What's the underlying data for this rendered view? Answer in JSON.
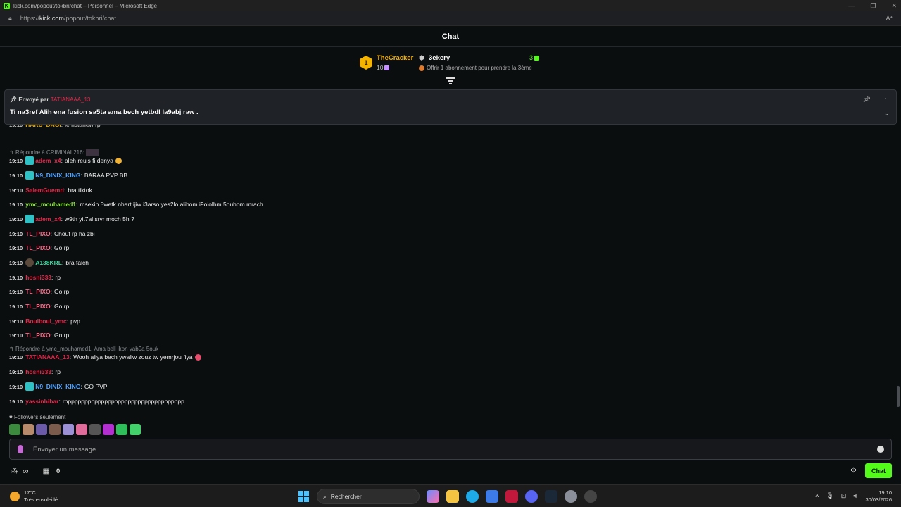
{
  "browser": {
    "window_title": "kick.com/popout/tokbri/chat – Personnel – Microsoft Edge",
    "url_prefix": "https://",
    "url_host": "kick.com",
    "url_path": "/popout/tokbri/chat"
  },
  "chat_header": {
    "title": "Chat"
  },
  "leaderboard": {
    "first": {
      "rank": "1",
      "name": "TheCracker",
      "gifts": "10"
    },
    "second": {
      "name": "3ekery",
      "gifts": "3",
      "offer": "Offrir 1 abonnement pour prendre la 3ème"
    }
  },
  "pinned": {
    "sent_by_label": "Envoyé par",
    "sender": "TATIANAAA_13",
    "message": "Ti na3ref Alih ena fusion sa5ta ama bech yetbdl la9abj raw ."
  },
  "messages": [
    {
      "time": "19:10",
      "user": "HAKU_DAGI",
      "color": "#f4b400",
      "text": "le nstanew rp",
      "badge": false
    },
    {
      "reply_to": "Répondre à CRIMINAL216:"
    },
    {
      "time": "19:10",
      "user": "adem_x4",
      "color": "#e8264a",
      "text": "aleh reuls fi denya",
      "badge": true,
      "emoji": "smile"
    },
    {
      "time": "19:10",
      "user": "N9_DINIX_KING",
      "color": "#57a6ff",
      "text": "BARAA PVP BB",
      "badge": true
    },
    {
      "time": "19:10",
      "user": "SalemGuemri",
      "color": "#e8264a",
      "text": "bra tiktok",
      "badge": false
    },
    {
      "time": "19:10",
      "user": "ymc_mouhamed1",
      "color": "#8ce83c",
      "text": "msekin 5wetk nhart ijiw i3arso yes2lo alihom i9ololhm 5ouhom mrach",
      "badge": false
    },
    {
      "time": "19:10",
      "user": "adem_x4",
      "color": "#e8264a",
      "text": "w9th yit7al srvr moch 5h ?",
      "badge": true
    },
    {
      "time": "19:10",
      "user": "TL_PIXO",
      "color": "#ff6a88",
      "text": "Chouf rp ha zbi",
      "badge": false
    },
    {
      "time": "19:10",
      "user": "TL_PIXO",
      "color": "#ff6a88",
      "text": "Go rp",
      "badge": false
    },
    {
      "time": "19:10",
      "user": "A138KRL",
      "color": "#3fd9a3",
      "text": "bra falch",
      "badge": true
    },
    {
      "time": "19:10",
      "user": "hosni333",
      "color": "#e8264a",
      "text": "rp",
      "badge": false
    },
    {
      "time": "19:10",
      "user": "TL_PIXO",
      "color": "#ff6a88",
      "text": "Go rp",
      "badge": false
    },
    {
      "time": "19:10",
      "user": "TL_PIXO",
      "color": "#ff6a88",
      "text": "Go rp",
      "badge": false
    },
    {
      "time": "19:10",
      "user": "Boulboul_ymc",
      "color": "#e8264a",
      "text": "pvp",
      "badge": false
    },
    {
      "time": "19:10",
      "user": "TL_PIXO",
      "color": "#ff6a88",
      "text": "Go rp",
      "badge": false
    },
    {
      "reply_to": "Répondre à ymc_mouhamed1: Ama bell ikon yab9a 5ouk"
    },
    {
      "time": "19:10",
      "user": "TATIANAAA_13",
      "color": "#e8264a",
      "text": "Wooh aliya bech ywaliw zouz tw yemrjou fiya",
      "badge": false,
      "emoji": "rage"
    },
    {
      "time": "19:10",
      "user": "hosni333",
      "color": "#e8264a",
      "text": "rp",
      "badge": false
    },
    {
      "time": "19:10",
      "user": "N9_DINIX_KING",
      "color": "#57a6ff",
      "text": "GO PVP",
      "badge": true
    },
    {
      "time": "19:10",
      "user": "yassinhibar",
      "color": "#e8264a",
      "text": "rpppppppppppppppppppppppppppppppppppp",
      "badge": false
    }
  ],
  "footer": {
    "followers_only": "Followers seulement",
    "input_placeholder": "Envoyer un message",
    "points": "0",
    "chat_button": "Chat"
  },
  "taskbar": {
    "temperature": "17°C",
    "weather": "Très ensoleillé",
    "search": "Rechercher",
    "time": "19:10",
    "date": "30/03/2026"
  },
  "colors": {
    "accent": "#53fc18",
    "pinned_user": "#e8264a"
  }
}
